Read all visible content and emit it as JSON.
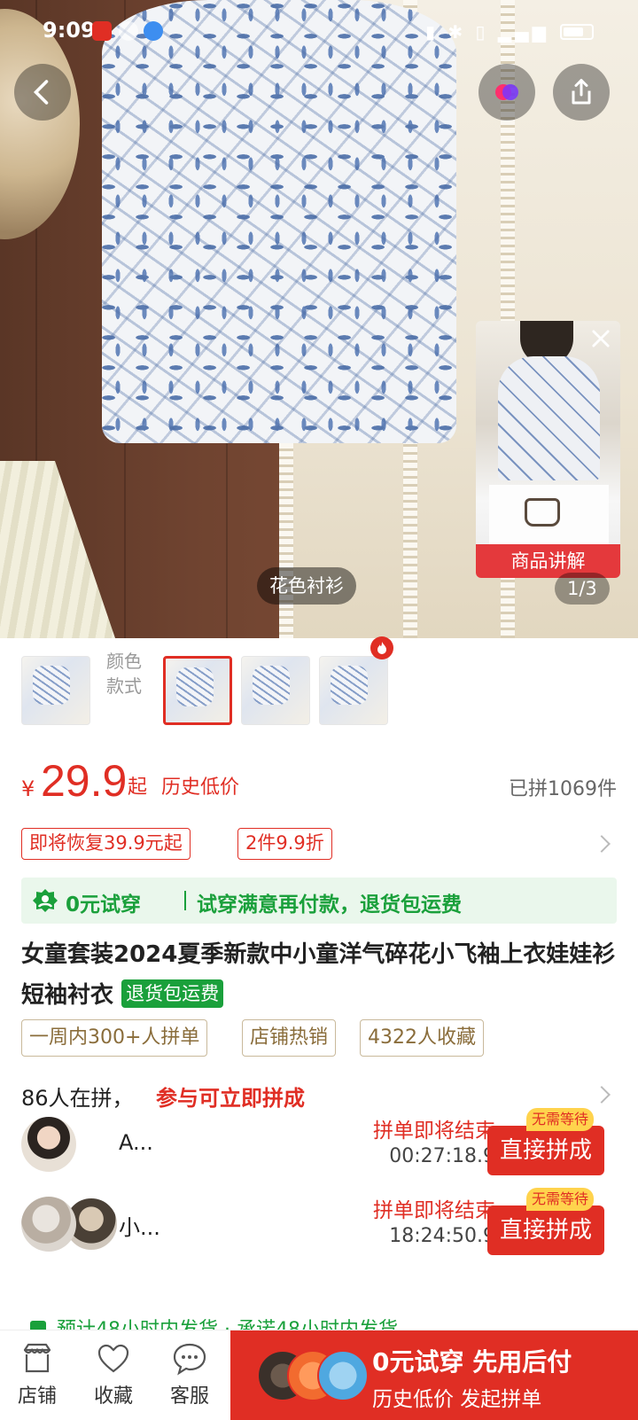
{
  "status_bar": {
    "time": "9:09"
  },
  "hero": {
    "caption": "花色衬衫",
    "counter": "1/3",
    "video_label": "商品讲解"
  },
  "variants": {
    "label_line1": "颜色",
    "label_line2": "款式"
  },
  "price": {
    "currency": "¥",
    "amount": "29.9",
    "suffix": "起",
    "tag": "历史低价",
    "sold": "已拼1069件"
  },
  "promos": [
    "即将恢复39.9元起",
    "2件9.9折"
  ],
  "trial": {
    "title": "0元试穿",
    "description": "试穿满意再付款，退货包运费"
  },
  "product": {
    "title": "女童套装2024夏季新款中小童洋气碎花小飞袖上衣娃娃衫短袖衬衣",
    "return_badge": "退货包运费"
  },
  "tags": [
    "一周内300+人拼单",
    "店铺热销",
    "4322人收藏"
  ],
  "group": {
    "count": "86人在拼，",
    "cta": "参与可立即拼成",
    "rows": [
      {
        "user": "A...",
        "status": "拼单即将结束",
        "timer": "00:27:18.9",
        "button": "直接拼成",
        "badge": "无需等待"
      },
      {
        "user": "小...",
        "status": "拼单即将结束",
        "timer": "18:24:50.9",
        "button": "直接拼成",
        "badge": "无需等待"
      }
    ]
  },
  "peek_text": "预计48小时内发货 · 承诺48小时内发货",
  "bottom_nav": {
    "items": [
      {
        "label": "店铺",
        "icon": "store-icon"
      },
      {
        "label": "收藏",
        "icon": "heart-icon"
      },
      {
        "label": "客服",
        "icon": "chat-icon"
      }
    ],
    "cta_line1": "0元试穿  先用后付",
    "cta_line2": "历史低价 发起拼单"
  },
  "colors": {
    "accent": "#e02e24",
    "green": "#1aa03b"
  }
}
